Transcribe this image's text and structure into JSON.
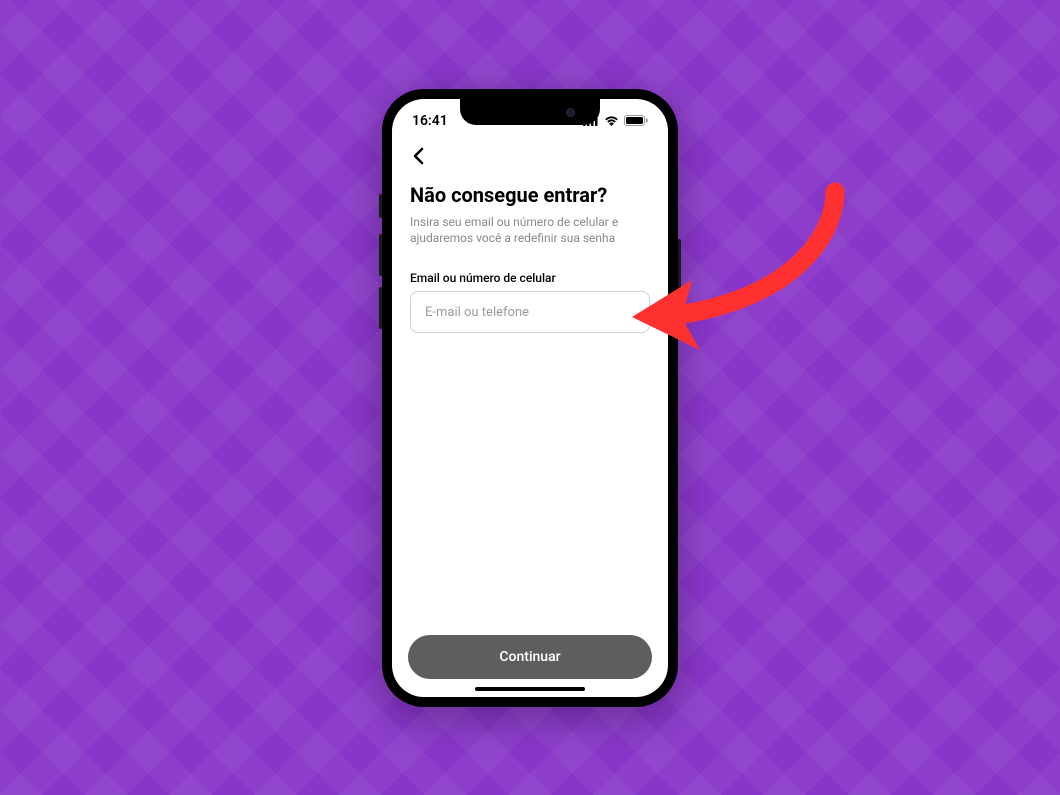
{
  "status_bar": {
    "time": "16:41"
  },
  "content": {
    "title": "Não consegue entrar?",
    "subtitle": "Insira seu email ou número de celular e ajudaremos você a redefinir sua senha",
    "field_label": "Email ou número de celular",
    "input_placeholder": "E-mail ou telefone"
  },
  "actions": {
    "continue_label": "Continuar"
  },
  "colors": {
    "background": "#8836C9",
    "arrow": "#FF3030",
    "button_bg": "#5e5e5e"
  }
}
